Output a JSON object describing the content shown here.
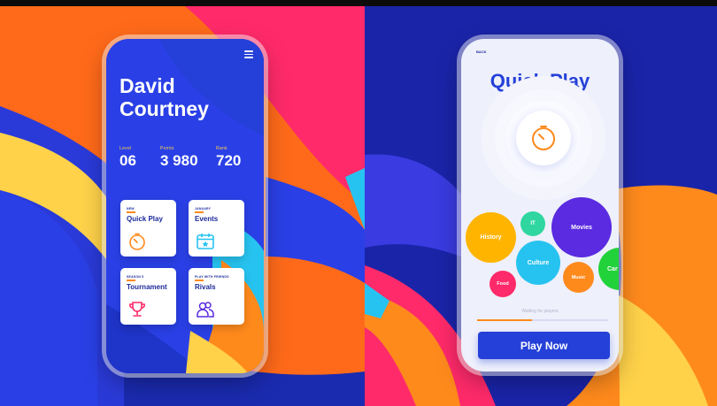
{
  "colors": {
    "primary_blue": "#2440d8",
    "navy": "#1b2a9a",
    "orange": "#ff8a1c",
    "pink": "#ff2a6a",
    "yellow": "#ffd24a",
    "cyan": "#27c3f0",
    "purple": "#5a2be0",
    "green": "#22d23a"
  },
  "profile": {
    "first_name": "David",
    "last_name": "Courtney",
    "stats": [
      {
        "label": "Level",
        "value": "06"
      },
      {
        "label": "Points",
        "value": "3 980"
      },
      {
        "label": "Rank",
        "value": "720"
      }
    ]
  },
  "tiles": [
    {
      "tag": "NEW",
      "title": "Quick Play",
      "icon": "stopwatch-icon"
    },
    {
      "tag": "JANUARY",
      "title": "Events",
      "icon": "calendar-star-icon"
    },
    {
      "tag": "SEASON 5",
      "title": "Tournament",
      "icon": "trophy-icon"
    },
    {
      "tag": "PLAY WITH FRIENDS",
      "title": "Rivals",
      "icon": "users-icon"
    }
  ],
  "quick_play": {
    "back_label": "BACK",
    "title": "Quick Play",
    "timer_icon": "stopwatch-icon",
    "categories": [
      {
        "label": "History",
        "color": "#ffb400"
      },
      {
        "label": "IT",
        "color": "#2fd6a0"
      },
      {
        "label": "Movies",
        "color": "#5a2be0"
      },
      {
        "label": "Culture",
        "color": "#27c3f0"
      },
      {
        "label": "Food",
        "color": "#ff2a6a"
      },
      {
        "label": "Music",
        "color": "#ff8a1c"
      },
      {
        "label": "Car",
        "color": "#22d23a"
      }
    ],
    "status_text": "Waiting for players",
    "progress": 0.42,
    "play_button": "Play Now"
  }
}
